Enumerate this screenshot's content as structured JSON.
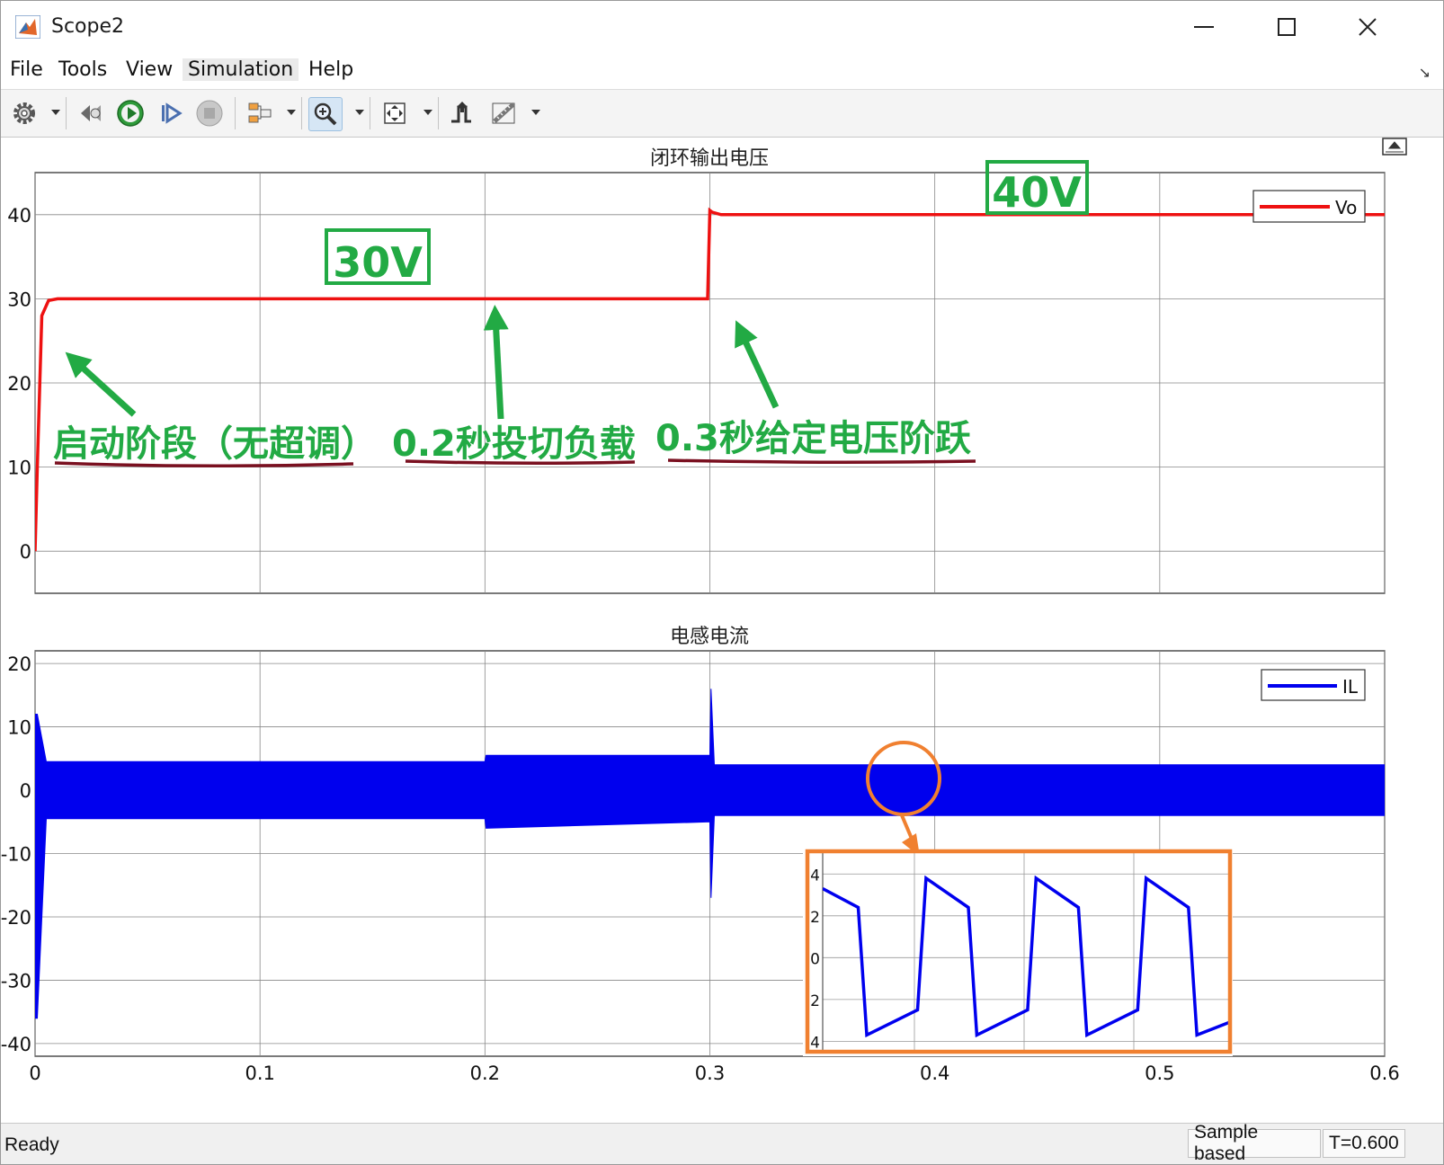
{
  "window": {
    "title": "Scope2"
  },
  "menu": {
    "items": [
      "File",
      "Tools",
      "View",
      "Simulation",
      "Help"
    ]
  },
  "toolbar": {
    "buttons": [
      "settings-icon",
      "step-back-icon",
      "run-icon",
      "step-forward-icon",
      "stop-icon",
      "signal-selector-icon",
      "zoom-icon",
      "autoscale-icon",
      "triggers-icon",
      "measurements-icon"
    ]
  },
  "plot1": {
    "title": "闭环输出电压",
    "legend": "Vo",
    "y_ticks": [
      "40",
      "30",
      "20",
      "10",
      "0"
    ],
    "annotations": {
      "box1": "30V",
      "box2": "40V",
      "label1": "启动阶段（无超调）",
      "label2": "0.2秒投切负载",
      "label3": "0.3秒给定电压阶跃"
    }
  },
  "plot2": {
    "title": "电感电流",
    "legend": "IL",
    "y_ticks": [
      "20",
      "10",
      "0",
      "-10",
      "-20",
      "-30",
      "-40"
    ],
    "inset_ticks": [
      "4",
      "2",
      "0",
      "2",
      "4"
    ]
  },
  "x_ticks": [
    "0",
    "0.1",
    "0.2",
    "0.3",
    "0.4",
    "0.5",
    "0.6"
  ],
  "status": {
    "ready": "Ready",
    "mode": "Sample based",
    "time": "T=0.600"
  },
  "colors": {
    "vo": "#ee1111",
    "il": "#0000ee",
    "annot_green": "#22aa44",
    "underline": "#7a1020",
    "inset_border": "#f08030"
  },
  "chart_data": [
    {
      "type": "line",
      "title": "闭环输出电压",
      "xlim": [
        0,
        0.6
      ],
      "ylim": [
        -5,
        45
      ],
      "grid": true,
      "legend_position": "top-right",
      "series": [
        {
          "name": "Vo",
          "x": [
            0,
            0.001,
            0.003,
            0.006,
            0.01,
            0.02,
            0.1,
            0.2,
            0.299,
            0.3,
            0.301,
            0.305,
            0.4,
            0.5,
            0.6
          ],
          "y": [
            0,
            10,
            28,
            29.8,
            30,
            30,
            30,
            30,
            30,
            40.5,
            40.3,
            40,
            40,
            40,
            40
          ]
        }
      ]
    },
    {
      "type": "area",
      "title": "电感电流",
      "xlim": [
        0,
        0.6
      ],
      "ylim": [
        -42,
        22
      ],
      "grid": true,
      "legend_position": "top-right",
      "series": [
        {
          "name": "IL",
          "x": [
            0,
            0.001,
            0.005,
            0.2,
            0.2005,
            0.3,
            0.3005,
            0.302,
            0.6
          ],
          "max": [
            12,
            12,
            4.5,
            4.5,
            5.5,
            5.5,
            16,
            4,
            4
          ],
          "min": [
            -36,
            -36,
            -4.5,
            -4.5,
            -6,
            -5,
            -17,
            -4,
            -4
          ]
        }
      ]
    },
    {
      "type": "line",
      "title": "",
      "ylim": [
        -4.5,
        5
      ],
      "grid": true,
      "series": [
        {
          "name": "IL (zoom)",
          "x": [
            0,
            1,
            2,
            3,
            4,
            5,
            6,
            7,
            8,
            9,
            10,
            11,
            12,
            13,
            14,
            15,
            16,
            17
          ],
          "y": [
            3.3,
            2.4,
            -3.7,
            -2.5,
            3.8,
            2.4,
            -3.7,
            -2.5,
            3.8,
            2.4,
            -3.7,
            -2.5,
            3.8,
            2.4,
            -3.7,
            -2.5,
            -2.2,
            -2.2
          ]
        }
      ]
    }
  ]
}
